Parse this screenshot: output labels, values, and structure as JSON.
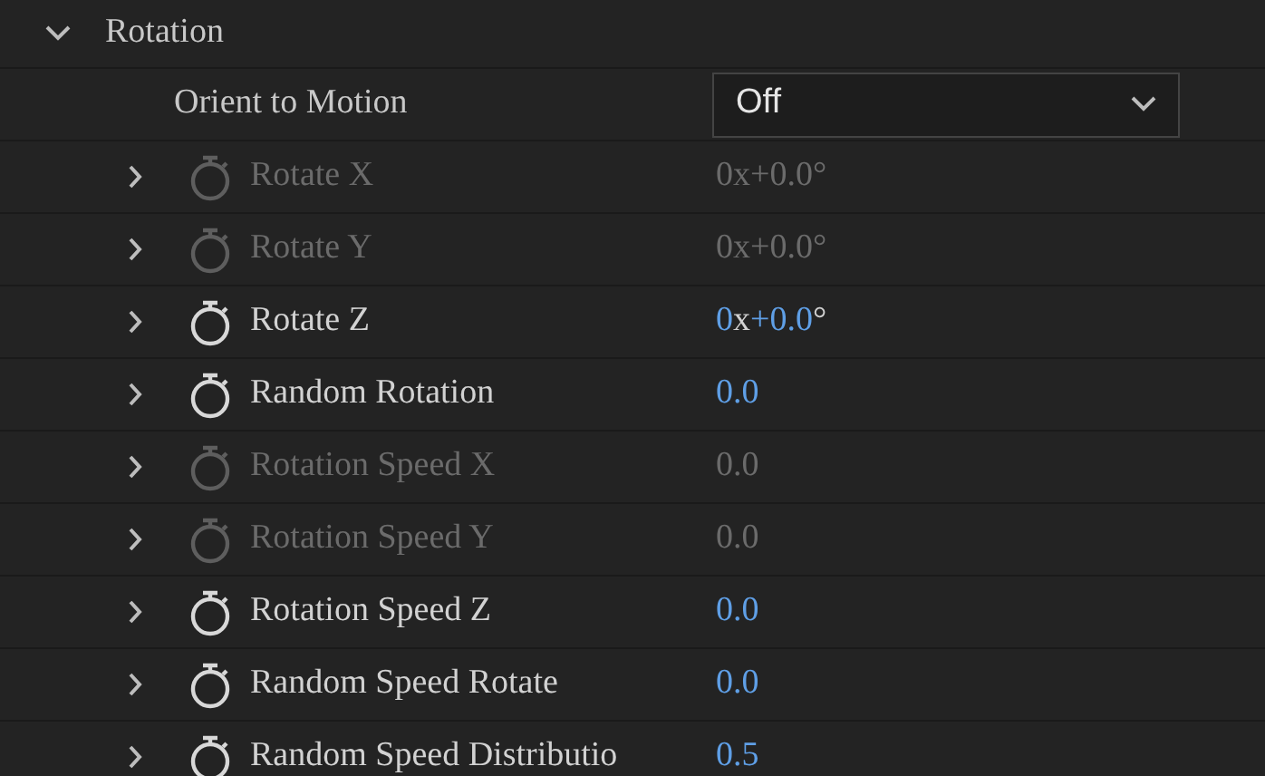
{
  "group": {
    "label": "Rotation",
    "expanded": true
  },
  "orient": {
    "label": "Orient to Motion",
    "value": "Off"
  },
  "properties": [
    {
      "label": "Rotate X",
      "enabled": false,
      "value": [
        {
          "text": "0",
          "kind": "number"
        },
        {
          "text": "x",
          "kind": "unit"
        },
        {
          "text": "+0.0",
          "kind": "number"
        },
        {
          "text": "°",
          "kind": "unit"
        }
      ]
    },
    {
      "label": "Rotate Y",
      "enabled": false,
      "value": [
        {
          "text": "0",
          "kind": "number"
        },
        {
          "text": "x",
          "kind": "unit"
        },
        {
          "text": "+0.0",
          "kind": "number"
        },
        {
          "text": "°",
          "kind": "unit"
        }
      ]
    },
    {
      "label": "Rotate Z",
      "enabled": true,
      "value": [
        {
          "text": "0",
          "kind": "number"
        },
        {
          "text": "x",
          "kind": "unit"
        },
        {
          "text": "+0.0",
          "kind": "number"
        },
        {
          "text": "°",
          "kind": "unit"
        }
      ]
    },
    {
      "label": "Random Rotation",
      "enabled": true,
      "value": [
        {
          "text": "0.0",
          "kind": "number"
        }
      ]
    },
    {
      "label": "Rotation Speed X",
      "enabled": false,
      "value": [
        {
          "text": "0.0",
          "kind": "number"
        }
      ]
    },
    {
      "label": "Rotation Speed Y",
      "enabled": false,
      "value": [
        {
          "text": "0.0",
          "kind": "number"
        }
      ]
    },
    {
      "label": "Rotation Speed Z",
      "enabled": true,
      "value": [
        {
          "text": "0.0",
          "kind": "number"
        }
      ]
    },
    {
      "label": "Random Speed Rotate",
      "enabled": true,
      "value": [
        {
          "text": "0.0",
          "kind": "number"
        }
      ]
    },
    {
      "label": "Random Speed Distributio",
      "enabled": true,
      "value": [
        {
          "text": "0.5",
          "kind": "number"
        }
      ]
    }
  ]
}
